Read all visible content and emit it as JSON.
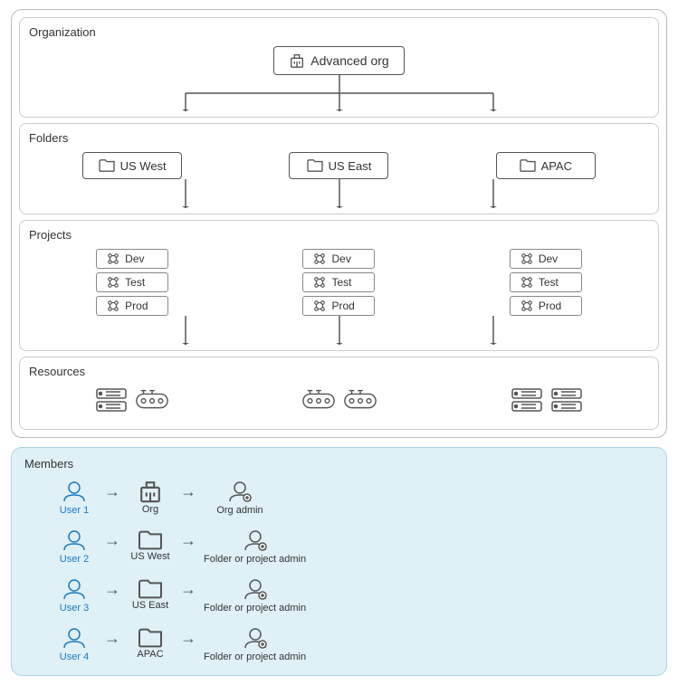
{
  "organization": {
    "label": "Organization",
    "org_name": "Advanced org"
  },
  "folders": {
    "label": "Folders",
    "items": [
      "US West",
      "US East",
      "APAC"
    ]
  },
  "projects": {
    "label": "Projects",
    "groups": [
      [
        "Dev",
        "Test",
        "Prod"
      ],
      [
        "Dev",
        "Test",
        "Prod"
      ],
      [
        "Dev",
        "Test",
        "Prod"
      ]
    ]
  },
  "resources": {
    "label": "Resources"
  },
  "members": {
    "label": "Members",
    "rows": [
      {
        "user": "User 1",
        "target": "Org",
        "role": "Org admin"
      },
      {
        "user": "User 2",
        "target": "US West",
        "role": "Folder or project admin"
      },
      {
        "user": "User 3",
        "target": "US East",
        "role": "Folder or project admin"
      },
      {
        "user": "User 4",
        "target": "APAC",
        "role": "Folder or project admin"
      }
    ]
  }
}
